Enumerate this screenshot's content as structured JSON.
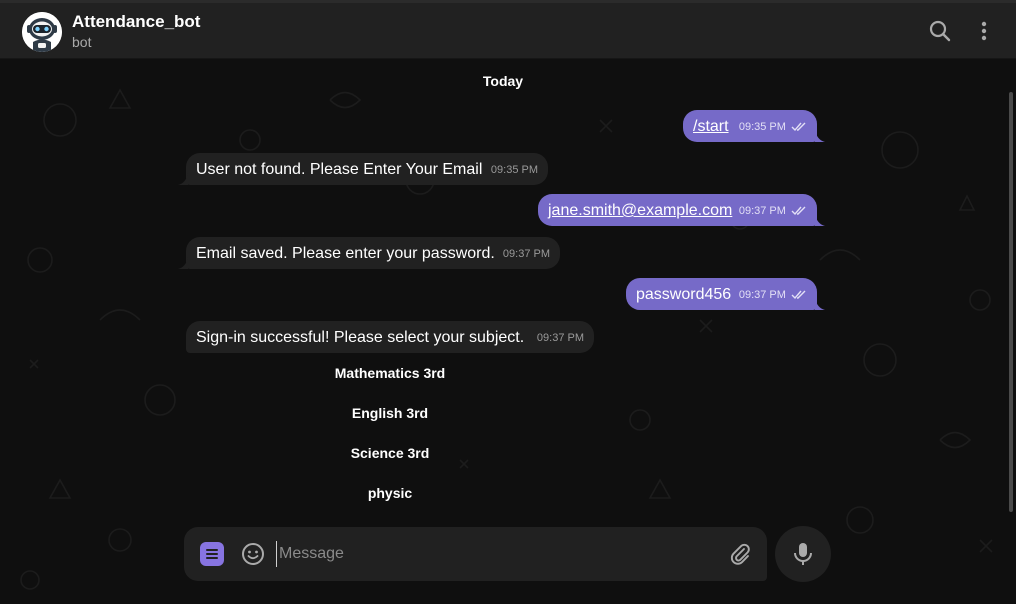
{
  "header": {
    "title": "Attendance_bot",
    "subtitle": "bot",
    "icons": [
      "bot-avatar",
      "search-icon",
      "more-vertical-icon"
    ]
  },
  "chat": {
    "date_label": "Today",
    "messages": [
      {
        "direction": "out",
        "text": "/start",
        "time": "09:35 PM",
        "link": true,
        "status": "read"
      },
      {
        "direction": "in",
        "text": "User not found. Please Enter Your Email",
        "time": "09:35 PM"
      },
      {
        "direction": "out",
        "text": "jane.smith@example.com",
        "time": "09:37 PM",
        "link": true,
        "status": "read"
      },
      {
        "direction": "in",
        "text": "Email saved. Please enter your password.",
        "time": "09:37 PM"
      },
      {
        "direction": "out",
        "text": "password456",
        "time": "09:37 PM",
        "link": false,
        "status": "read"
      },
      {
        "direction": "in",
        "text": "Sign-in successful! Please select your subject.",
        "time": "09:37 PM"
      }
    ],
    "keyboard_buttons": [
      "Mathematics 3rd",
      "English 3rd",
      "Science 3rd",
      "physic"
    ]
  },
  "composer": {
    "placeholder": "Message",
    "value": "",
    "icons": [
      "bot-menu-icon",
      "emoji-icon",
      "attach-icon",
      "microphone-icon"
    ]
  },
  "colors": {
    "background": "#0f0f0f",
    "panel": "#212121",
    "outgoing_bubble": "#766ac8",
    "accent": "#8774e1"
  }
}
